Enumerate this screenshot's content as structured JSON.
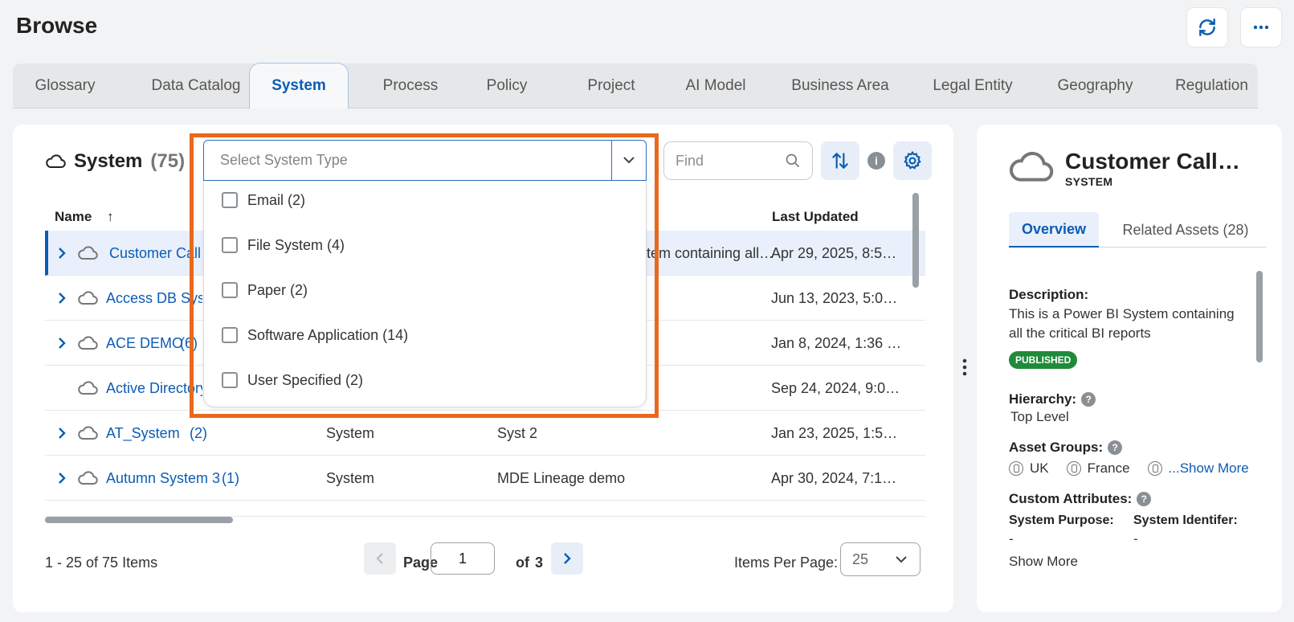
{
  "header": {
    "title": "Browse"
  },
  "icons": {
    "refresh": "refresh-icon",
    "more": "more-horizontal-icon"
  },
  "tabs": [
    {
      "label": "Glossary"
    },
    {
      "label": "Data Catalog"
    },
    {
      "label": "System"
    },
    {
      "label": "Process"
    },
    {
      "label": "Policy"
    },
    {
      "label": "Project"
    },
    {
      "label": "AI Model"
    },
    {
      "label": "Business Area"
    },
    {
      "label": "Legal Entity"
    },
    {
      "label": "Geography"
    },
    {
      "label": "Regulation"
    }
  ],
  "list": {
    "title": "System",
    "count": "(75)",
    "filter_placeholder": "Select System Type",
    "find_placeholder": "Find",
    "columns": {
      "name": "Name",
      "sort_indicator": "↑",
      "last_updated": "Last Updated"
    },
    "rows": [
      {
        "name": "Customer Call",
        "count": "",
        "type": "",
        "desc": "stem containing all…",
        "updated": "Apr 29, 2025, 8:5…",
        "expandable": true
      },
      {
        "name": "Access DB Syst",
        "count": "",
        "type": "",
        "desc": "",
        "updated": "Jun 13, 2023, 5:0…",
        "expandable": true
      },
      {
        "name": "ACE DEMO",
        "count": "(6)",
        "type": "",
        "desc": "",
        "updated": "Jan 8, 2024, 1:36 …",
        "expandable": true
      },
      {
        "name": "Active Directory",
        "count": "",
        "type": "",
        "desc": "",
        "updated": "Sep 24, 2024, 9:0…",
        "expandable": false
      },
      {
        "name": "AT_System",
        "count": "(2)",
        "type": "System",
        "desc": "Syst 2",
        "updated": "Jan 23, 2025, 1:5…",
        "expandable": true
      },
      {
        "name": "Autumn System 3",
        "count": "(1)",
        "type": "System",
        "desc": "MDE Lineage demo",
        "updated": "Apr 30, 2024, 7:1…",
        "expandable": true
      }
    ],
    "dropdown_options": [
      {
        "label": "Email (2)"
      },
      {
        "label": "File System (4)"
      },
      {
        "label": "Paper (2)"
      },
      {
        "label": "Software Application (14)"
      },
      {
        "label": "User Specified (2)"
      }
    ],
    "pagination": {
      "range": "1 - 25 of 75 Items",
      "page_label": "Page",
      "page": "1",
      "of_label": "of",
      "total_pages": "3",
      "ipp_label": "Items Per Page:",
      "ipp_value": "25"
    }
  },
  "detail": {
    "title": "Customer Call…",
    "subtitle": "SYSTEM",
    "tabs": [
      {
        "label": "Overview"
      },
      {
        "label": "Related Assets (28)"
      }
    ],
    "description_label": "Description:",
    "description": "This is a Power BI System containing all the critical BI reports",
    "status": "PUBLISHED",
    "hierarchy_label": "Hierarchy:",
    "hierarchy": "Top Level",
    "asset_groups_label": "Asset Groups:",
    "asset_groups": [
      "UK",
      "France"
    ],
    "show_more_groups": "...Show More",
    "custom_attributes_label": "Custom Attributes:",
    "attr1_label": "System Purpose:",
    "attr1_value": "-",
    "attr2_label": "System Identifer:",
    "attr2_value": "-",
    "show_more": "Show More"
  },
  "colors": {
    "accent": "#0b5cb5",
    "highlight": "#e8691c",
    "published": "#1f8b3a"
  }
}
